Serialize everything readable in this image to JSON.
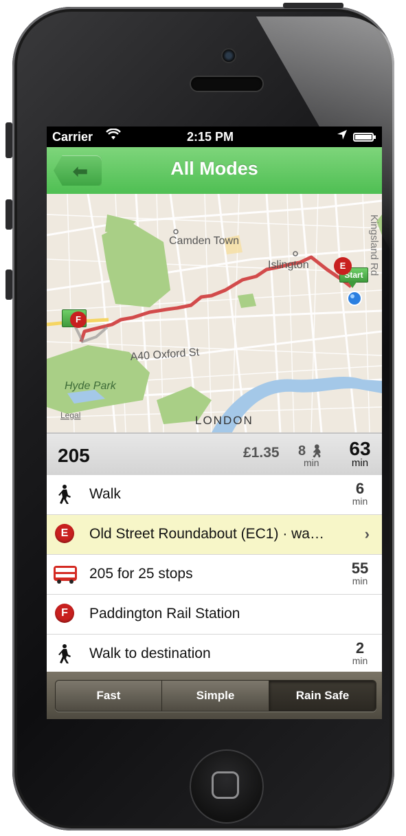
{
  "status_bar": {
    "carrier": "Carrier",
    "time": "2:15 PM"
  },
  "nav": {
    "title": "All Modes"
  },
  "map": {
    "labels": {
      "camden": "Camden Town",
      "islington": "Islington",
      "kingsland": "Kingsland Rd",
      "oxford": "A40  Oxford St",
      "hyde": "Hyde Park",
      "london": "LONDON",
      "legal": "Legal"
    },
    "start_marker": "Start",
    "stop_e": "E",
    "stop_f": "F"
  },
  "summary": {
    "route": "205",
    "fare": "£1.35",
    "walk_value": "8",
    "walk_unit": "min",
    "total_value": "63",
    "total_unit": "min"
  },
  "steps": [
    {
      "icon": "walk",
      "text": "Walk",
      "duration": "6",
      "unit": "min"
    },
    {
      "icon": "E",
      "text": "Old Street Roundabout (EC1) · wa…",
      "chevron": "›"
    },
    {
      "icon": "bus",
      "text": "205 for 25 stops",
      "duration": "55",
      "unit": "min"
    },
    {
      "icon": "F",
      "text": "Paddington Rail Station"
    },
    {
      "icon": "walk",
      "text": "Walk to destination",
      "duration": "2",
      "unit": "min"
    }
  ],
  "toolbar": {
    "fast": "Fast",
    "simple": "Simple",
    "rain_safe": "Rain Safe",
    "selected": "Rain Safe"
  },
  "colors": {
    "nav_green": "#4fbf53",
    "route_red": "#d24b4b",
    "highlight": "#f7f6c8",
    "stop_red": "#c8201f"
  }
}
